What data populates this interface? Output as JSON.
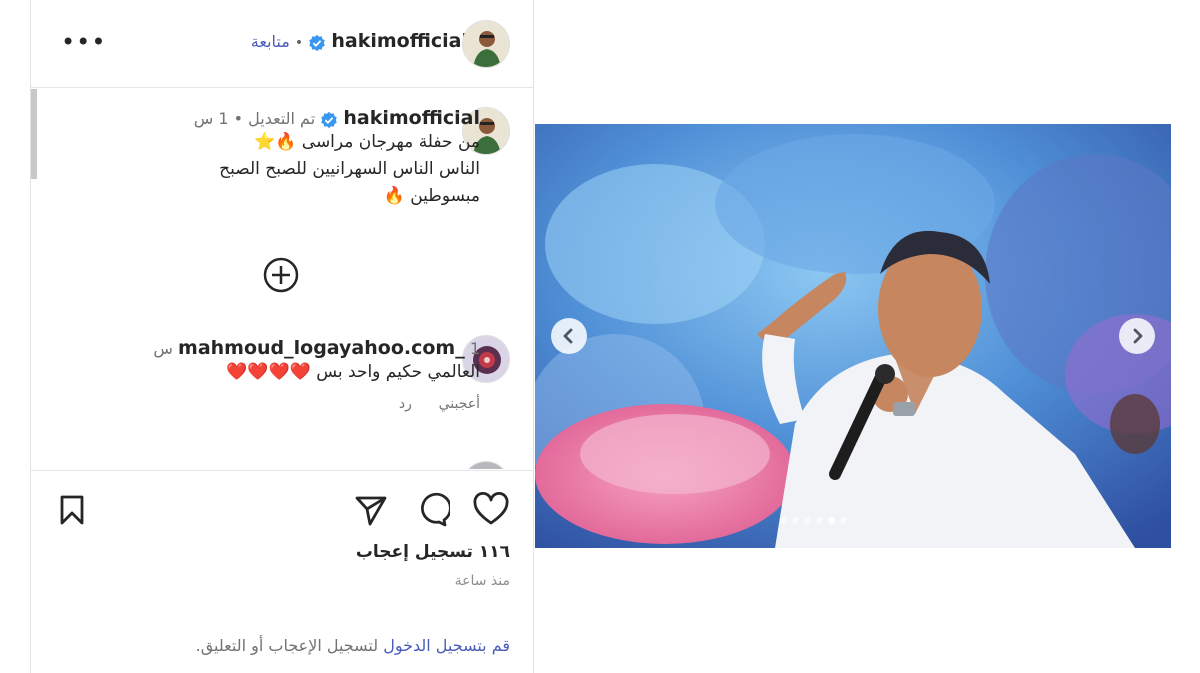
{
  "header": {
    "username": "hakimofficial",
    "follow_label": "متابعة",
    "separator": "•",
    "more_label": "•••"
  },
  "caption": {
    "username": "hakimofficial",
    "edited_label": "تم التعديل",
    "separator": "•",
    "time": "1 س",
    "line1": "من حفلة مهرجان مراسى 🔥⭐",
    "line2": "الناس الناس السهرانيين للصبح الصبح",
    "line3": "مبسوطين 🔥"
  },
  "comments": [
    {
      "username": "mahmoud_logayahoo.com_",
      "time": "1 س",
      "text": "العالمي حكيم واحد بس ❤️❤️❤️❤️",
      "like_label": "أعجبني",
      "reply_label": "رد"
    }
  ],
  "actions": {
    "likes_text": "١١٦ تسجيل إعجاب",
    "posted_ago": "منذ ساعة",
    "login_link": "قم بتسجيل الدخول",
    "login_rest": " لتسجيل الإعجاب أو التعليق."
  },
  "carousel": {
    "dot_count": 6,
    "active_index": 4
  },
  "colors": {
    "verified": "#3897f0",
    "link": "#4a5db8",
    "muted": "#737373"
  }
}
